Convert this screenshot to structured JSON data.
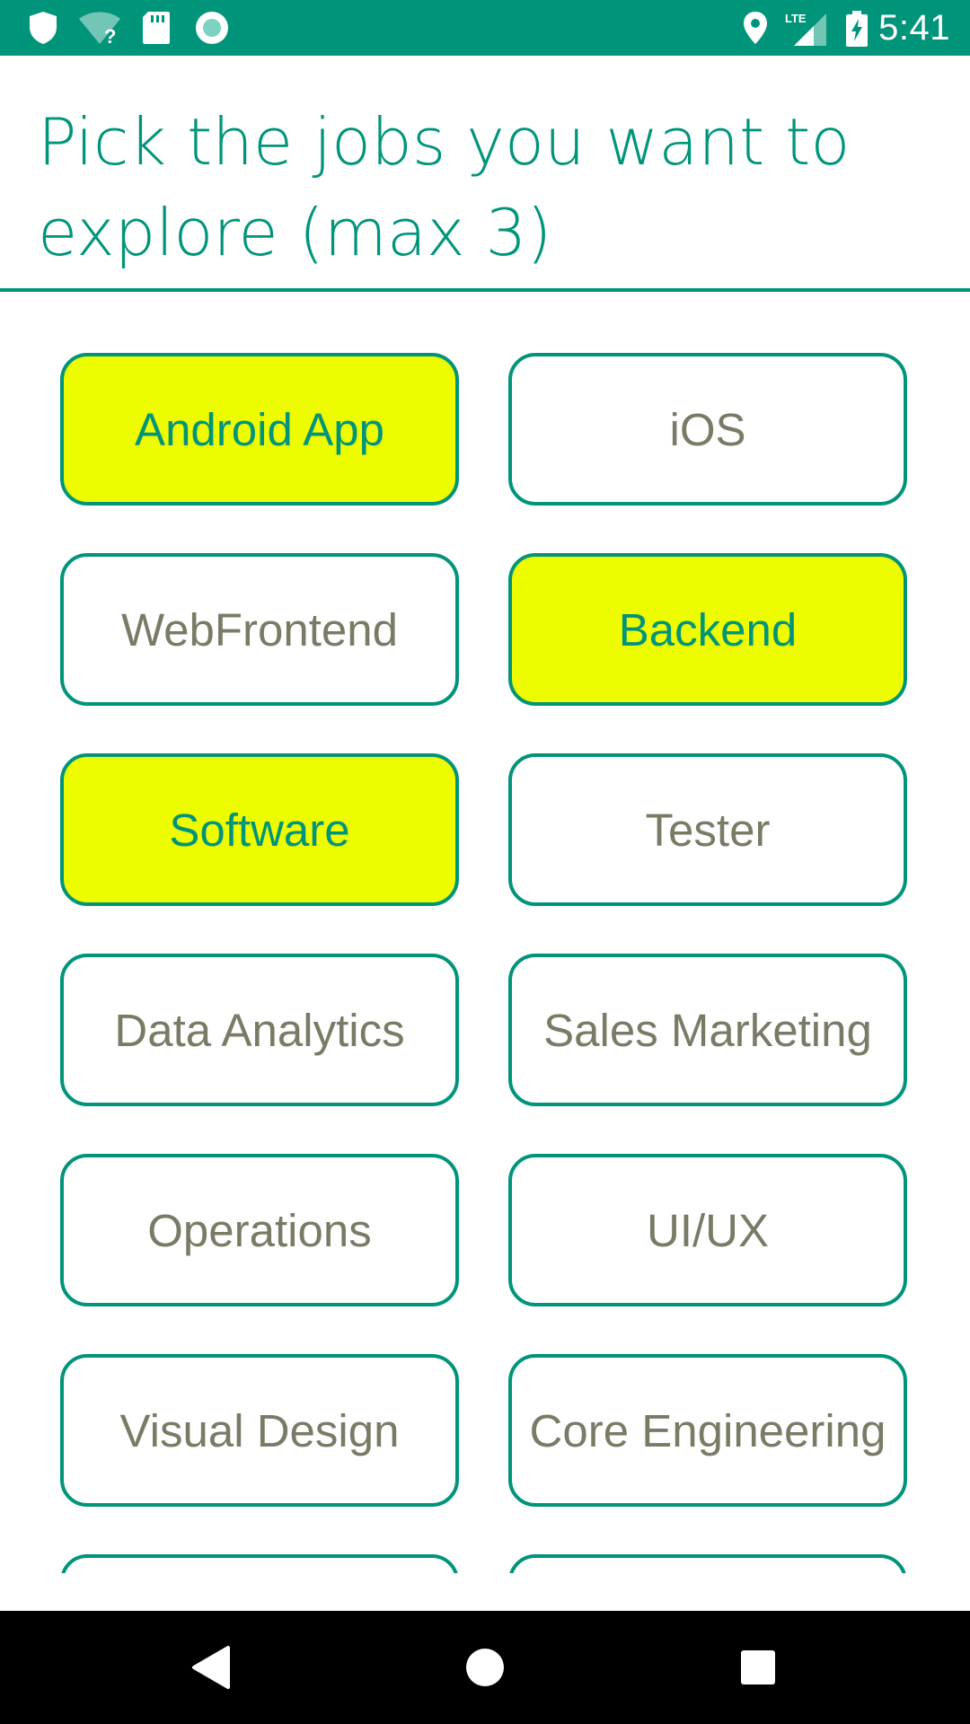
{
  "status_bar": {
    "time": "5:41",
    "background_color": "#00957a",
    "left_icons": [
      "shield-icon",
      "wifi-unknown-icon",
      "sd-card-icon",
      "record-icon"
    ],
    "right_icons": [
      "location-pin-icon",
      "lte-signal-icon",
      "battery-charging-icon"
    ],
    "lte_label": "LTE"
  },
  "header": {
    "title": "Pick the jobs you want to explore (max 3)",
    "accent_color": "#00957a"
  },
  "jobs": [
    {
      "label": "Android App",
      "selected": true
    },
    {
      "label": "iOS",
      "selected": false
    },
    {
      "label": "WebFrontend",
      "selected": false
    },
    {
      "label": "Backend",
      "selected": true
    },
    {
      "label": "Software",
      "selected": true
    },
    {
      "label": "Tester",
      "selected": false
    },
    {
      "label": "Data Analytics",
      "selected": false
    },
    {
      "label": "Sales Marketing",
      "selected": false
    },
    {
      "label": "Operations",
      "selected": false
    },
    {
      "label": "UI/UX",
      "selected": false
    },
    {
      "label": "Visual Design",
      "selected": false
    },
    {
      "label": "Core Engineering",
      "selected": false
    },
    {
      "label": "",
      "selected": false
    },
    {
      "label": "",
      "selected": false
    }
  ],
  "colors": {
    "selected_fill": "#eefc00",
    "chip_border": "#00957a",
    "unselected_text": "#7a7a66"
  },
  "nav_bar": {
    "buttons": [
      "back-icon",
      "home-icon",
      "recents-icon"
    ]
  }
}
